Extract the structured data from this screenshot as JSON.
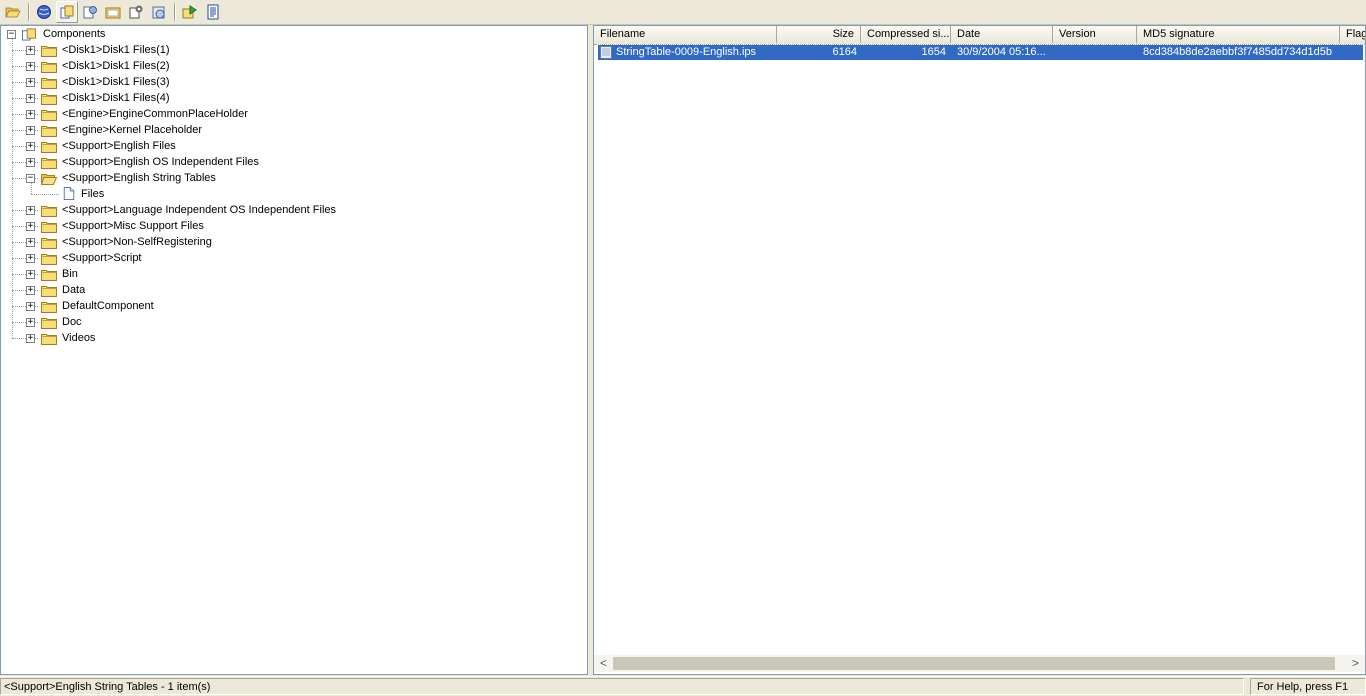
{
  "toolbar": {
    "buttons": [
      {
        "icon": "open-folder-icon"
      },
      {
        "icon": "globe-icon"
      },
      {
        "icon": "components-icon",
        "pressed": true
      },
      {
        "icon": "setup-types-icon"
      },
      {
        "icon": "file-groups-icon"
      },
      {
        "icon": "properties-icon"
      },
      {
        "icon": "media-icon"
      },
      {
        "icon": "extract-icon"
      },
      {
        "icon": "report-icon"
      }
    ]
  },
  "tree": {
    "root_label": "Components",
    "items": [
      {
        "label": "<Disk1>Disk1 Files(1)",
        "expanded": false
      },
      {
        "label": "<Disk1>Disk1 Files(2)",
        "expanded": false
      },
      {
        "label": "<Disk1>Disk1 Files(3)",
        "expanded": false
      },
      {
        "label": "<Disk1>Disk1 Files(4)",
        "expanded": false
      },
      {
        "label": "<Engine>EngineCommonPlaceHolder",
        "expanded": false
      },
      {
        "label": "<Engine>Kernel Placeholder",
        "expanded": false
      },
      {
        "label": "<Support>English Files",
        "expanded": false
      },
      {
        "label": "<Support>English OS Independent Files",
        "expanded": false
      },
      {
        "label": "<Support>English String Tables",
        "expanded": true
      },
      {
        "label": "<Support>Language Independent OS Independent Files",
        "expanded": false
      },
      {
        "label": "<Support>Misc Support Files",
        "expanded": false
      },
      {
        "label": "<Support>Non-SelfRegistering",
        "expanded": false
      },
      {
        "label": "<Support>Script",
        "expanded": false
      },
      {
        "label": "Bin",
        "expanded": false
      },
      {
        "label": "Data",
        "expanded": false
      },
      {
        "label": "DefaultComponent",
        "expanded": false
      },
      {
        "label": "Doc",
        "expanded": false
      },
      {
        "label": "Videos",
        "expanded": false
      }
    ],
    "child_label": "Files"
  },
  "list": {
    "columns": [
      "Filename",
      "Size",
      "Compressed si...",
      "Date",
      "Version",
      "MD5 signature",
      "Flag"
    ],
    "rows": [
      {
        "filename": "StringTable-0009-English.ips",
        "size": "6164",
        "compressed": "1654",
        "date": "30/9/2004 05:16...",
        "version": "",
        "md5": "8cd384b8de2aebbf3f7485dd734d1d5b"
      }
    ]
  },
  "scrollbar": {
    "left_arrow": "<",
    "right_arrow": ">"
  },
  "status": {
    "left": "<Support>English String Tables - 1 item(s)",
    "right": "For Help, press F1"
  },
  "colors": {
    "selection": "#316ac5",
    "folder": "#f5d56b",
    "pane_border": "#7f9db9"
  }
}
